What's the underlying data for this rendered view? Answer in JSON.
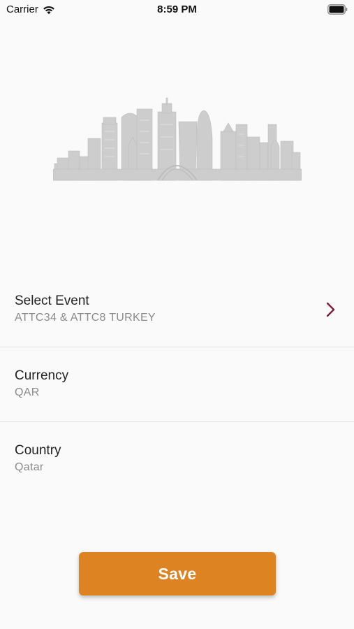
{
  "status_bar": {
    "carrier": "Carrier",
    "time": "8:59 PM"
  },
  "settings": {
    "event": {
      "label": "Select Event",
      "value": "ATTC34 & ATTC8 TURKEY"
    },
    "currency": {
      "label": "Currency",
      "value": "QAR"
    },
    "country": {
      "label": "Country",
      "value": "Qatar"
    }
  },
  "save_button": {
    "label": "Save"
  },
  "colors": {
    "accent": "#de8322",
    "chevron": "#7a1f3d",
    "skyline": "#c9c9c9"
  }
}
